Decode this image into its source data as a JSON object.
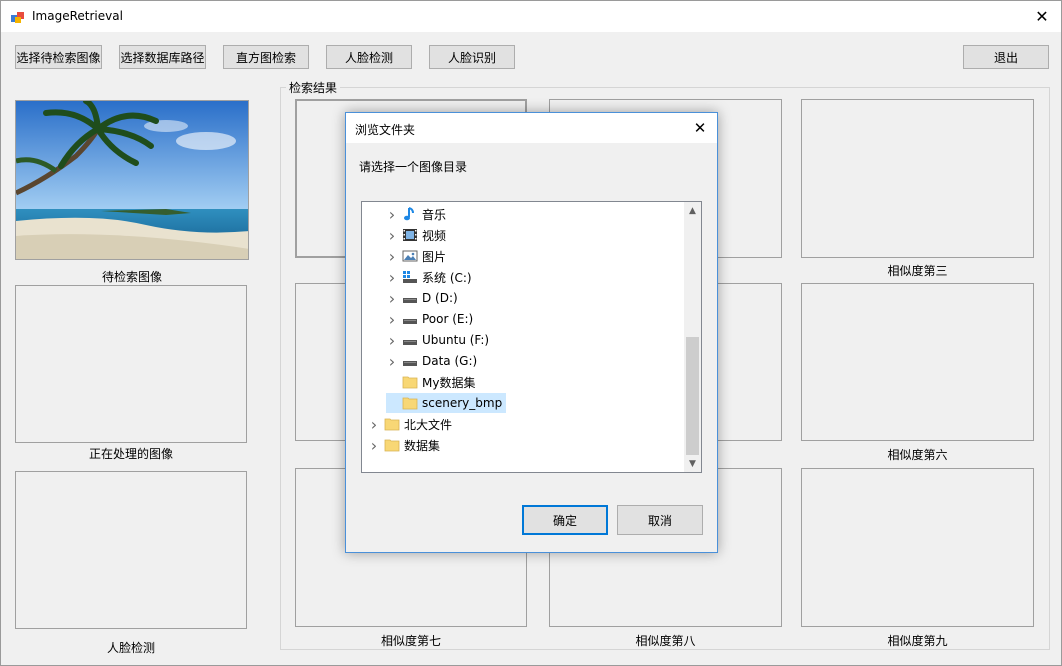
{
  "window": {
    "title": "ImageRetrieval"
  },
  "toolbar": {
    "select_query": "选择待检索图像",
    "select_db": "选择数据库路径",
    "histogram": "直方图检索",
    "face_detect": "人脸检测",
    "face_recognize": "人脸识别",
    "exit": "退出"
  },
  "left": {
    "query_caption": "待检索图像",
    "processing_caption": "正在处理的图像",
    "face_caption": "人脸检测"
  },
  "results": {
    "group_title": "检索结果",
    "captions": [
      "相似度第三",
      "相似度第六",
      "相似度第七",
      "相似度第八",
      "相似度第九"
    ]
  },
  "dialog": {
    "title": "浏览文件夹",
    "instruction": "请选择一个图像目录",
    "items": [
      {
        "label": "音乐",
        "icon": "music-icon",
        "expandable": true,
        "indent": 1
      },
      {
        "label": "视频",
        "icon": "video-icon",
        "expandable": true,
        "indent": 1
      },
      {
        "label": "图片",
        "icon": "picture-icon",
        "expandable": true,
        "indent": 1
      },
      {
        "label": "系统 (C:)",
        "icon": "system-drive-icon",
        "expandable": true,
        "indent": 1
      },
      {
        "label": "D (D:)",
        "icon": "drive-icon",
        "expandable": true,
        "indent": 1
      },
      {
        "label": "Poor (E:)",
        "icon": "drive-icon",
        "expandable": true,
        "indent": 1
      },
      {
        "label": "Ubuntu (F:)",
        "icon": "drive-icon",
        "expandable": true,
        "indent": 1
      },
      {
        "label": "Data (G:)",
        "icon": "drive-icon",
        "expandable": true,
        "indent": 1
      },
      {
        "label": "My数据集",
        "icon": "folder-icon",
        "expandable": false,
        "indent": 1
      },
      {
        "label": "scenery_bmp",
        "icon": "folder-icon",
        "expandable": false,
        "indent": 1,
        "selected": true
      },
      {
        "label": "北大文件",
        "icon": "folder-icon",
        "expandable": true,
        "indent": 0
      },
      {
        "label": "数据集",
        "icon": "folder-icon",
        "expandable": true,
        "indent": 0
      }
    ],
    "ok": "确定",
    "cancel": "取消"
  },
  "colors": {
    "selection": "#cce8ff",
    "focus_border": "#0078d7",
    "dialog_border": "#4a90d9"
  }
}
